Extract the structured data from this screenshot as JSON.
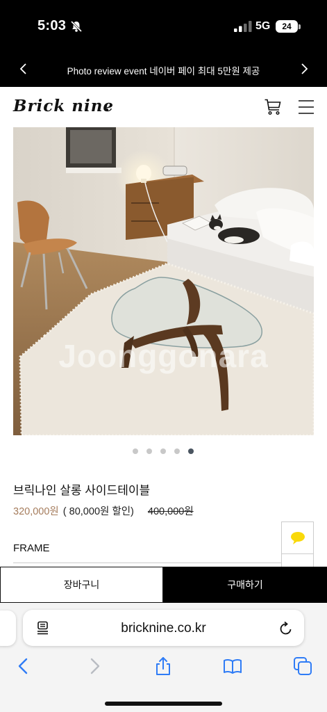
{
  "status_bar": {
    "time": "5:03",
    "network": "5G",
    "battery": "24"
  },
  "promo": {
    "text": "Photo review event 네이버 페이 최대 5만원 제공"
  },
  "header": {
    "logo": "Brick nine"
  },
  "product": {
    "watermark": "Joonggonara",
    "carousel": {
      "count": 5,
      "active_index": 4
    },
    "name": "브릭나인 살롱 사이드테이블",
    "sale_price": "320,000원",
    "discount": "( 80,000원 할인)",
    "original_price": "400,000원",
    "option_label": "FRAME"
  },
  "actions": {
    "cart_label": "장바구니",
    "buy_label": "구매하기"
  },
  "browser": {
    "url": "bricknine.co.kr"
  },
  "colors": {
    "sale_price": "#a57c5c",
    "chat_bubble": "#f9d90a",
    "ios_blue": "#2f7cf6"
  }
}
